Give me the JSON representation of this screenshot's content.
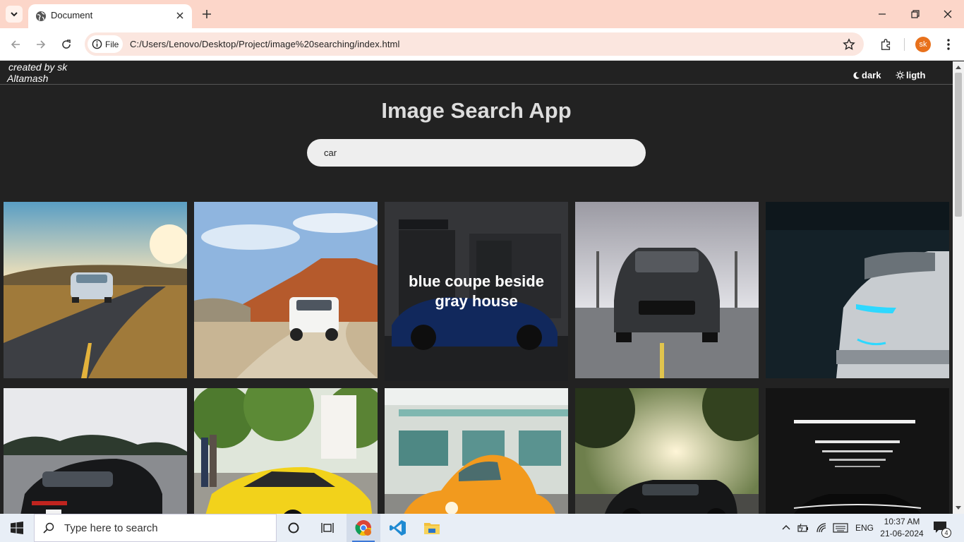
{
  "browser": {
    "tab_title": "Document",
    "site_chip": "File",
    "url": "C:/Users/Lenovo/Desktop/Project/image%20searching/index.html",
    "profile_initials": "sk"
  },
  "page": {
    "credit_line1": "created by sk",
    "credit_line2": "Altamash",
    "dark_label": "dark",
    "light_label": "ligth",
    "heading": "Image Search App",
    "search_value": "car",
    "background": "#222222",
    "hover_caption": "blue coupe beside gray house"
  },
  "results": [
    {
      "subject": "silver sports car on winding road at sunset",
      "hovered": false
    },
    {
      "subject": "white SUV on desert road",
      "hovered": false
    },
    {
      "subject": "blue coupe beside gray house",
      "hovered": true
    },
    {
      "subject": "black muscle car front view",
      "hovered": false
    },
    {
      "subject": "white car with blue headlights in dark garage",
      "hovered": false
    },
    {
      "subject": "black porsche on road",
      "hovered": false
    },
    {
      "subject": "yellow lamborghini under trees",
      "hovered": false
    },
    {
      "subject": "orange beetle in front of building",
      "hovered": false
    },
    {
      "subject": "black mustang with sunlight behind",
      "hovered": false
    },
    {
      "subject": "car in dark tunnel with lights",
      "hovered": false
    }
  ],
  "taskbar": {
    "search_placeholder": "Type here to search",
    "language": "ENG",
    "time": "10:37 AM",
    "date": "21-06-2024",
    "notification_count": "4"
  }
}
